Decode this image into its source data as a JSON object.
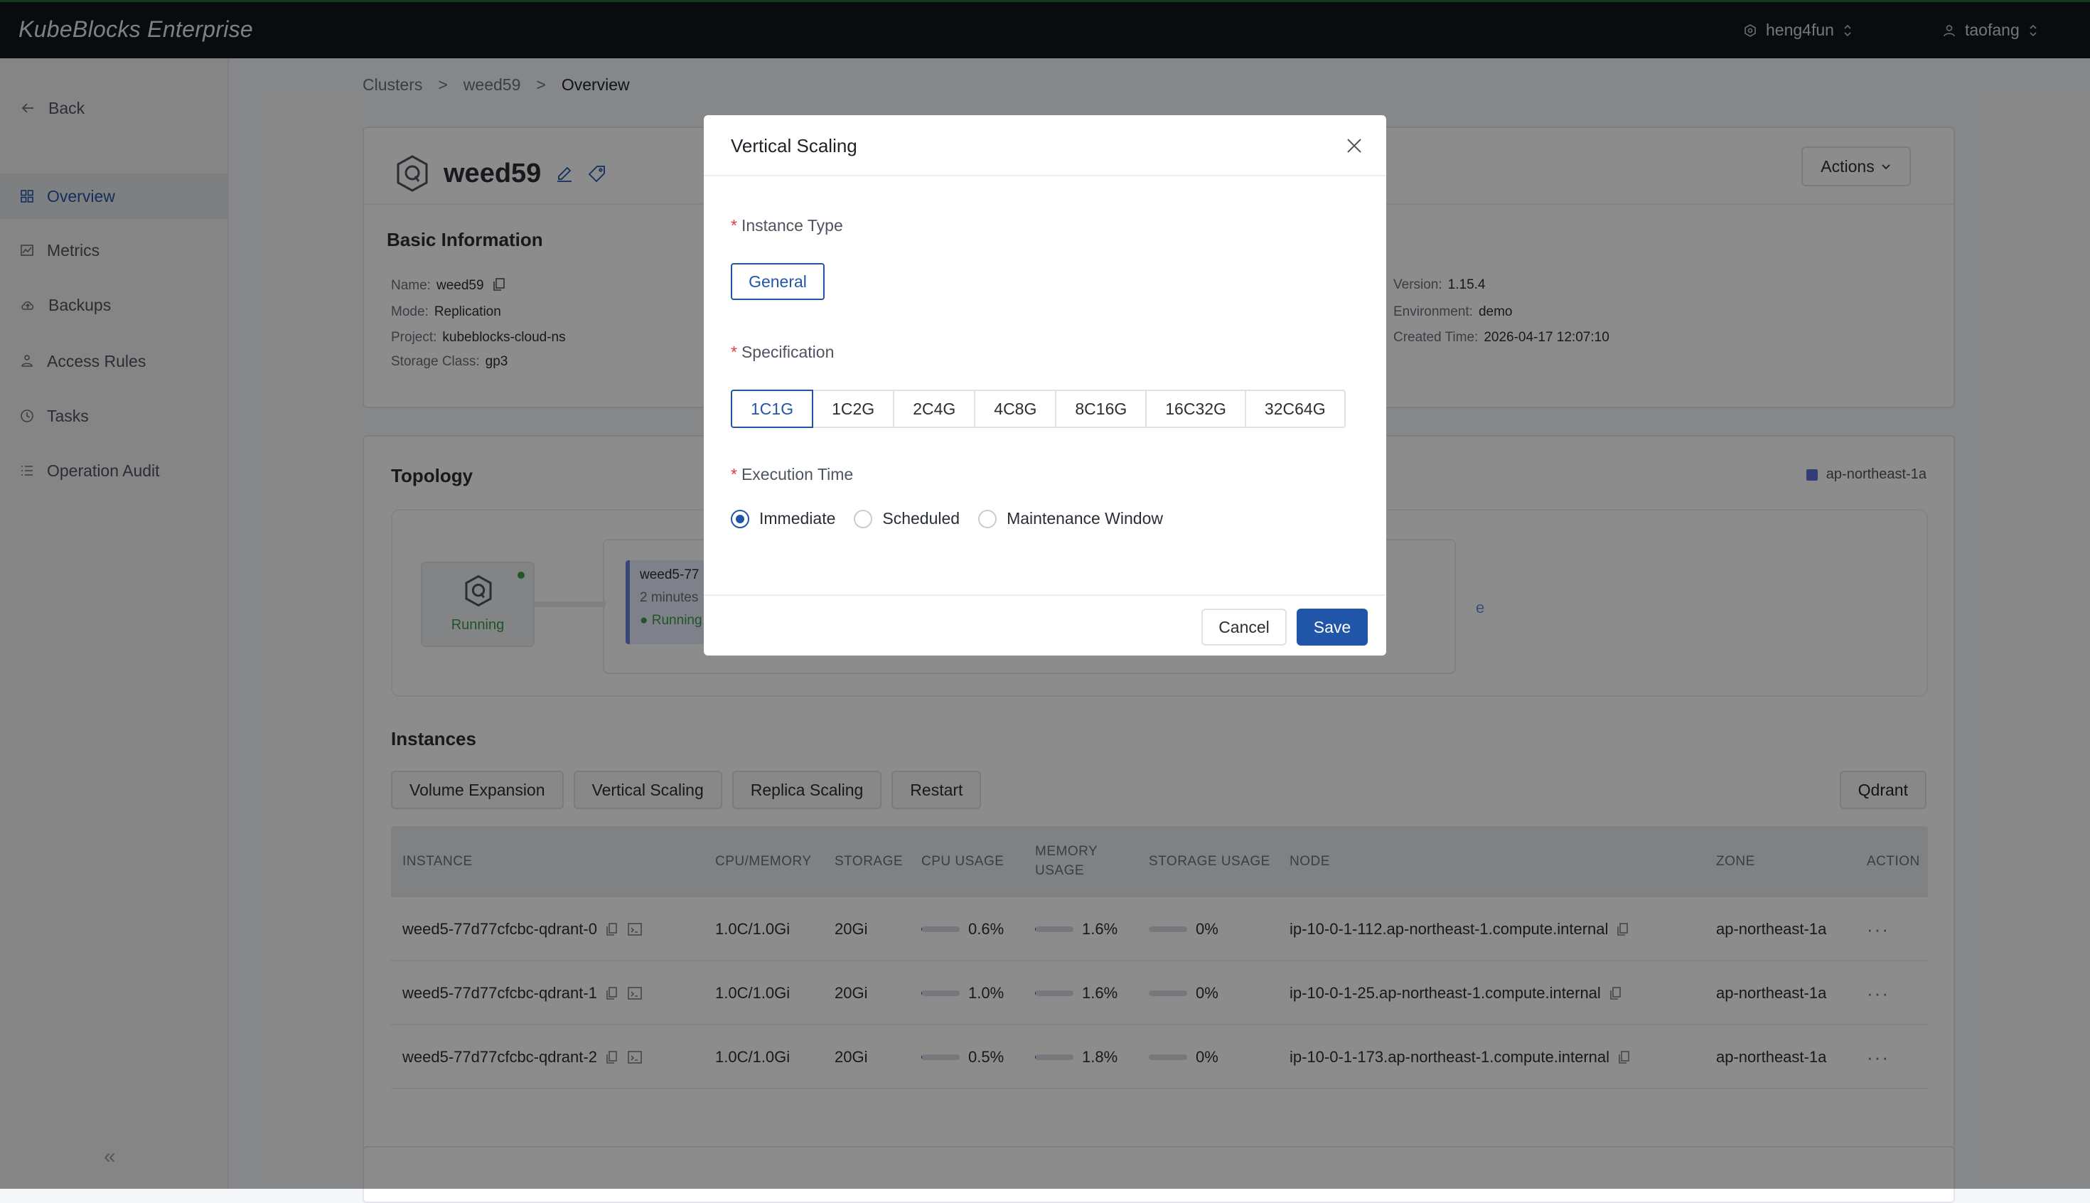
{
  "app": {
    "brand": "KubeBlocks Enterprise",
    "org": "heng4fun",
    "user": "taofang"
  },
  "sidebar": {
    "back": "Back",
    "items": [
      {
        "label": "Overview"
      },
      {
        "label": "Metrics"
      },
      {
        "label": "Backups"
      },
      {
        "label": "Access Rules"
      },
      {
        "label": "Tasks"
      },
      {
        "label": "Operation Audit"
      }
    ],
    "collapse": "«"
  },
  "breadcrumb": {
    "items": [
      "Clusters",
      "weed59",
      "Overview"
    ],
    "sep": ">"
  },
  "cluster": {
    "name": "weed59",
    "actions": "Actions",
    "basic_title": "Basic Information",
    "fields": {
      "name_label": "Name:",
      "name_value": "weed59",
      "mode_label": "Mode:",
      "mode_value": "Replication",
      "project_label": "Project:",
      "project_value": "kubeblocks-cloud-ns",
      "storage_label": "Storage Class:",
      "storage_value": "gp3",
      "version_label": "Version:",
      "version_value": "1.15.4",
      "env_label": "Environment:",
      "env_value": "demo",
      "created_label": "Created Time:",
      "created_value": "2026-04-17 12:07:10"
    }
  },
  "topology": {
    "title": "Topology",
    "zone_legend": "ap-northeast-1a",
    "node_status": "Running",
    "instance_name": "weed5-77",
    "instance_age": "2 minutes",
    "instance_status": "Running",
    "hidden_char": "e"
  },
  "instances": {
    "title": "Instances",
    "buttons": [
      "Volume Expansion",
      "Vertical Scaling",
      "Replica Scaling",
      "Restart"
    ],
    "engine": "Qdrant",
    "columns": [
      "INSTANCE",
      "CPU/MEMORY",
      "STORAGE",
      "CPU USAGE",
      "MEMORY USAGE",
      "STORAGE USAGE",
      "NODE",
      "ZONE",
      "ACTION"
    ],
    "rows": [
      {
        "name": "weed5-77d77cfcbc-qdrant-0",
        "cpu_mem": "1.0C/1.0Gi",
        "storage": "20Gi",
        "cpu": "0.6%",
        "cpu_pct": 0.6,
        "mem": "1.6%",
        "mem_pct": 1.6,
        "stor": "0%",
        "stor_pct": 0,
        "node": "ip-10-0-1-112.ap-northeast-1.compute.internal",
        "zone": "ap-northeast-1a",
        "action": "···"
      },
      {
        "name": "weed5-77d77cfcbc-qdrant-1",
        "cpu_mem": "1.0C/1.0Gi",
        "storage": "20Gi",
        "cpu": "1.0%",
        "cpu_pct": 1.0,
        "mem": "1.6%",
        "mem_pct": 1.6,
        "stor": "0%",
        "stor_pct": 0,
        "node": "ip-10-0-1-25.ap-northeast-1.compute.internal",
        "zone": "ap-northeast-1a",
        "action": "···"
      },
      {
        "name": "weed5-77d77cfcbc-qdrant-2",
        "cpu_mem": "1.0C/1.0Gi",
        "storage": "20Gi",
        "cpu": "0.5%",
        "cpu_pct": 0.5,
        "mem": "1.8%",
        "mem_pct": 1.8,
        "stor": "0%",
        "stor_pct": 0,
        "node": "ip-10-0-1-173.ap-northeast-1.compute.internal",
        "zone": "ap-northeast-1a",
        "action": "···"
      }
    ]
  },
  "modal": {
    "title": "Vertical Scaling",
    "required_mark": "*",
    "instance_type_label": "Instance Type",
    "instance_type": "General",
    "spec_label": "Specification",
    "specs": [
      "1C1G",
      "1C2G",
      "2C4G",
      "4C8G",
      "8C16G",
      "16C32G",
      "32C64G"
    ],
    "selected_spec": "1C1G",
    "exec_label": "Execution Time",
    "exec_options": [
      "Immediate",
      "Scheduled",
      "Maintenance Window"
    ],
    "selected_exec": "Immediate",
    "cancel": "Cancel",
    "save": "Save"
  },
  "colors": {
    "accent": "#2155a8",
    "running": "#3c9a46",
    "topbar": "#12151c"
  }
}
